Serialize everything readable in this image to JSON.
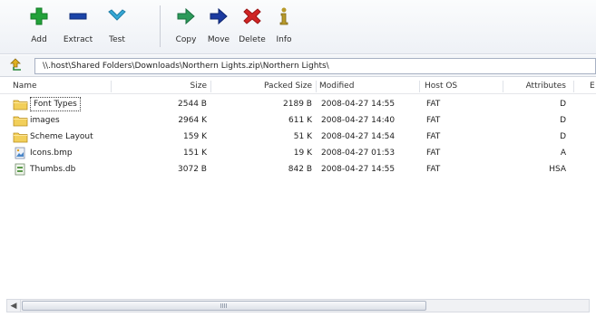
{
  "toolbar": {
    "left_buttons": [
      {
        "label": "Add",
        "icon": "plus-icon",
        "color": "#22a13a"
      },
      {
        "label": "Extract",
        "icon": "minus-icon",
        "color": "#1b44a8"
      },
      {
        "label": "Test",
        "icon": "check-chevron-icon",
        "color": "#36a8d6"
      }
    ],
    "right_buttons": [
      {
        "label": "Copy",
        "icon": "copy-arrow-icon",
        "color": "#2c9a5a"
      },
      {
        "label": "Move",
        "icon": "move-arrow-icon",
        "color": "#1b3aa0"
      },
      {
        "label": "Delete",
        "icon": "delete-x-icon",
        "color": "#d02424"
      },
      {
        "label": "Info",
        "icon": "info-icon",
        "color": "#b89a2a"
      }
    ]
  },
  "address": {
    "path": "\\\\.host\\Shared Folders\\Downloads\\Northern Lights.zip\\Northern Lights\\"
  },
  "columns": {
    "name": "Name",
    "size": "Size",
    "packed": "Packed Size",
    "modified": "Modified",
    "host_os": "Host OS",
    "attributes": "Attributes",
    "extra": "E"
  },
  "rows": [
    {
      "name": "Font Types",
      "icon": "folder-icon",
      "size": "2544 B",
      "packed": "2189 B",
      "modified": "2008-04-27 14:55",
      "host_os": "FAT",
      "attributes": "D"
    },
    {
      "name": "images",
      "icon": "folder-icon",
      "size": "2964 K",
      "packed": "611 K",
      "modified": "2008-04-27 14:40",
      "host_os": "FAT",
      "attributes": "D"
    },
    {
      "name": "Scheme Layout",
      "icon": "folder-icon",
      "size": "159 K",
      "packed": "51 K",
      "modified": "2008-04-27 14:54",
      "host_os": "FAT",
      "attributes": "D"
    },
    {
      "name": "Icons.bmp",
      "icon": "bitmap-file-icon",
      "size": "151 K",
      "packed": "19 K",
      "modified": "2008-04-27 01:53",
      "host_os": "FAT",
      "attributes": "A"
    },
    {
      "name": "Thumbs.db",
      "icon": "db-file-icon",
      "size": "3072 B",
      "packed": "842 B",
      "modified": "2008-04-27 14:55",
      "host_os": "FAT",
      "attributes": "HSA"
    }
  ]
}
